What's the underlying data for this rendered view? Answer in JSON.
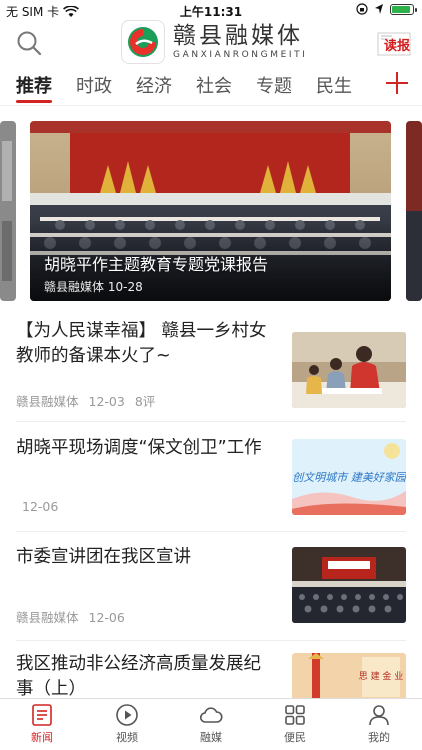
{
  "status_bar": {
    "carrier": "无 SIM 卡",
    "time": "上午11:31",
    "battery_level": 0.8
  },
  "header": {
    "logo_cn": "赣县融媒体",
    "logo_en": "GANXIANRONGMEITI",
    "read_paper_label": "读报"
  },
  "tabs": [
    {
      "label": "推荐",
      "active": true
    },
    {
      "label": "时政"
    },
    {
      "label": "经济"
    },
    {
      "label": "社会"
    },
    {
      "label": "专题"
    },
    {
      "label": "民生"
    }
  ],
  "carousel": {
    "main": {
      "title": "胡晓平作主题教育专题党课报告",
      "source": "赣县融媒体",
      "date": "10-28"
    }
  },
  "news": [
    {
      "title": "【为人民谋幸福】 赣县一乡村女教师的备课本火了~",
      "source": "赣县融媒体",
      "date": "12-03",
      "comments": "8评"
    },
    {
      "title": "胡晓平现场调度“保文创卫”工作",
      "source": "",
      "date": "12-06",
      "comments": ""
    },
    {
      "title": "市委宣讲团在我区宣讲",
      "source": "赣县融媒体",
      "date": "12-06",
      "comments": ""
    },
    {
      "title": "我区推动非公经济高质量发展纪事（上）",
      "source": "",
      "date": "",
      "comments": ""
    }
  ],
  "thumb_text": {
    "banner2": "创文明城市 建美好家园",
    "banner4": "思 建 金 业"
  },
  "bottom_nav": [
    {
      "label": "新闻",
      "icon": "news-list-icon",
      "active": true
    },
    {
      "label": "视频",
      "icon": "play-circle-icon"
    },
    {
      "label": "融媒",
      "icon": "cloud-icon"
    },
    {
      "label": "便民",
      "icon": "grid-icon"
    },
    {
      "label": "我的",
      "icon": "user-icon"
    }
  ],
  "colors": {
    "accent": "#d32424",
    "text": "#222222",
    "meta": "#999999"
  }
}
